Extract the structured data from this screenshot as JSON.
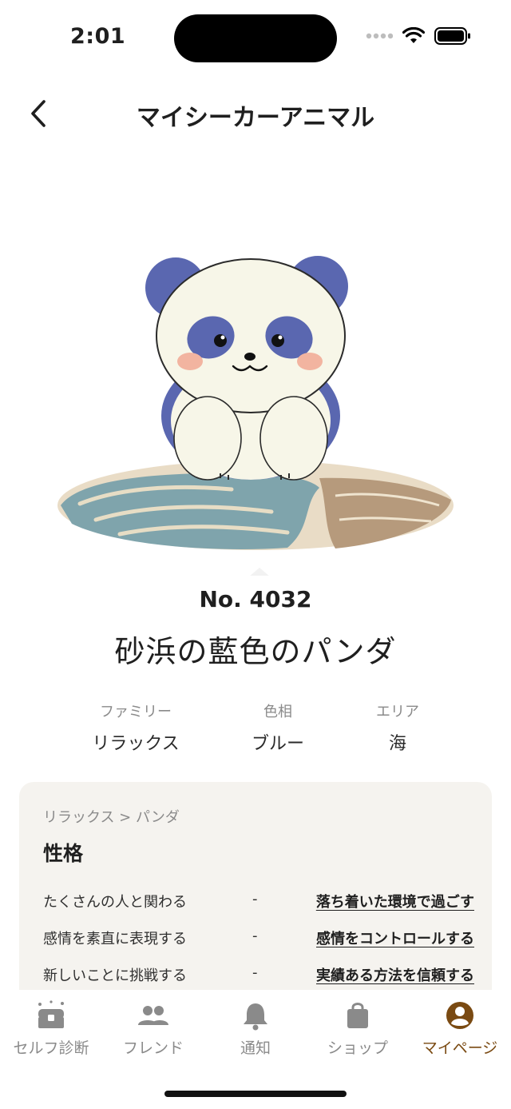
{
  "status_bar": {
    "time": "2:01"
  },
  "header": {
    "title": "マイシーカーアニマル"
  },
  "animal": {
    "number": "No. 4032",
    "name": "砂浜の藍色のパンダ"
  },
  "attributes": [
    {
      "label": "ファミリー",
      "value": "リラックス"
    },
    {
      "label": "色相",
      "value": "ブルー"
    },
    {
      "label": "エリア",
      "value": "海"
    }
  ],
  "personality": {
    "breadcrumb": "リラックス > パンダ",
    "title": "性格",
    "traits": [
      {
        "left": "たくさんの人と関わる",
        "separator": "-",
        "right": "落ち着いた環境で過ごす"
      },
      {
        "left": "感情を素直に表現する",
        "separator": "-",
        "right": "感情をコントロールする"
      },
      {
        "left": "新しいことに挑戦する",
        "separator": "-",
        "right": "実績ある方法を信頼する"
      }
    ]
  },
  "tabs": [
    {
      "label": "セルフ診断",
      "icon": "treasure-chest-icon",
      "active": false
    },
    {
      "label": "フレンド",
      "icon": "people-icon",
      "active": false
    },
    {
      "label": "通知",
      "icon": "bell-icon",
      "active": false
    },
    {
      "label": "ショップ",
      "icon": "shopping-bag-icon",
      "active": false
    },
    {
      "label": "マイページ",
      "icon": "user-circle-icon",
      "active": true
    }
  ],
  "colors": {
    "accent": "#7a4a12",
    "panda_blue": "#5a67b0",
    "card_bg": "#f5f3ef",
    "inactive": "#8a8a8a"
  }
}
